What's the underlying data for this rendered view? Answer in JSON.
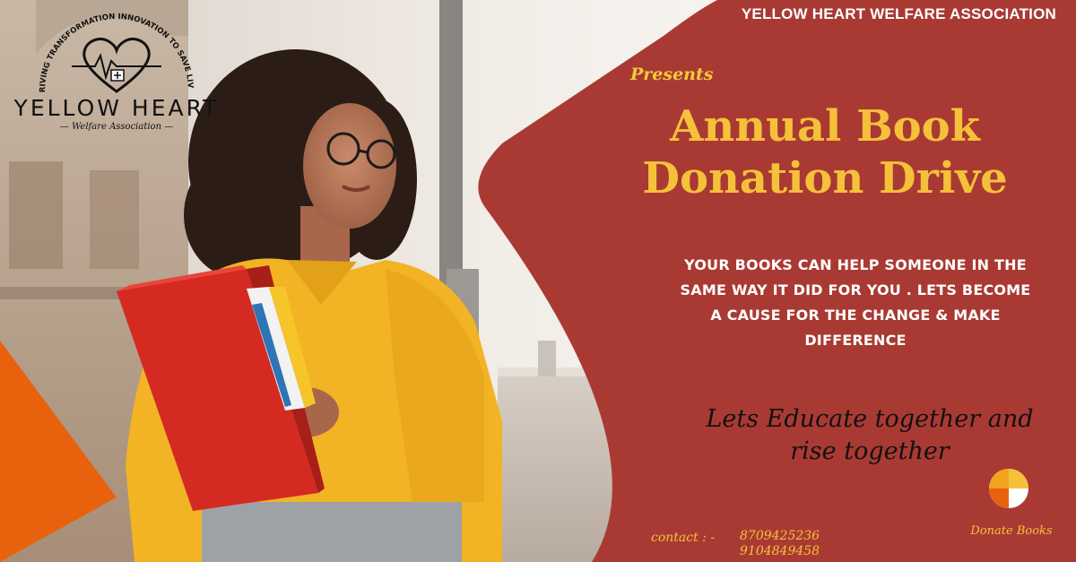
{
  "organization": {
    "name": "YELLOW HEART WELFARE ASSOCIATION",
    "logo_arc_text": "DRIVING TRANSFORMATION INNOVATION TO SAVE LIVES",
    "logo_wordmark": "YELLOW HEART",
    "logo_subtitle": "Welfare Association"
  },
  "presents": "Presents",
  "headline": {
    "line1": "Annual Book",
    "line2": "Donation Drive"
  },
  "pitch": {
    "line1": "YOUR BOOKS CAN HELP SOMEONE IN THE",
    "line2": "SAME WAY IT DID FOR YOU . LETS BECOME",
    "line3": "A CAUSE FOR THE CHANGE & MAKE",
    "line4": "DIFFERENCE"
  },
  "slogan": {
    "line1": "Lets Educate together and",
    "line2": "rise together"
  },
  "contact": {
    "label": "contact : -",
    "phone1": "8709425236",
    "phone2": "9104849458"
  },
  "donate": {
    "label": "Donate Books",
    "icon": "donate-pie-icon"
  },
  "colors": {
    "banner": "#a93a33",
    "accent_yellow": "#f6c13a",
    "accent_orange": "#e8620e",
    "shirt": "#f2b424",
    "folder": "#d42a22"
  }
}
